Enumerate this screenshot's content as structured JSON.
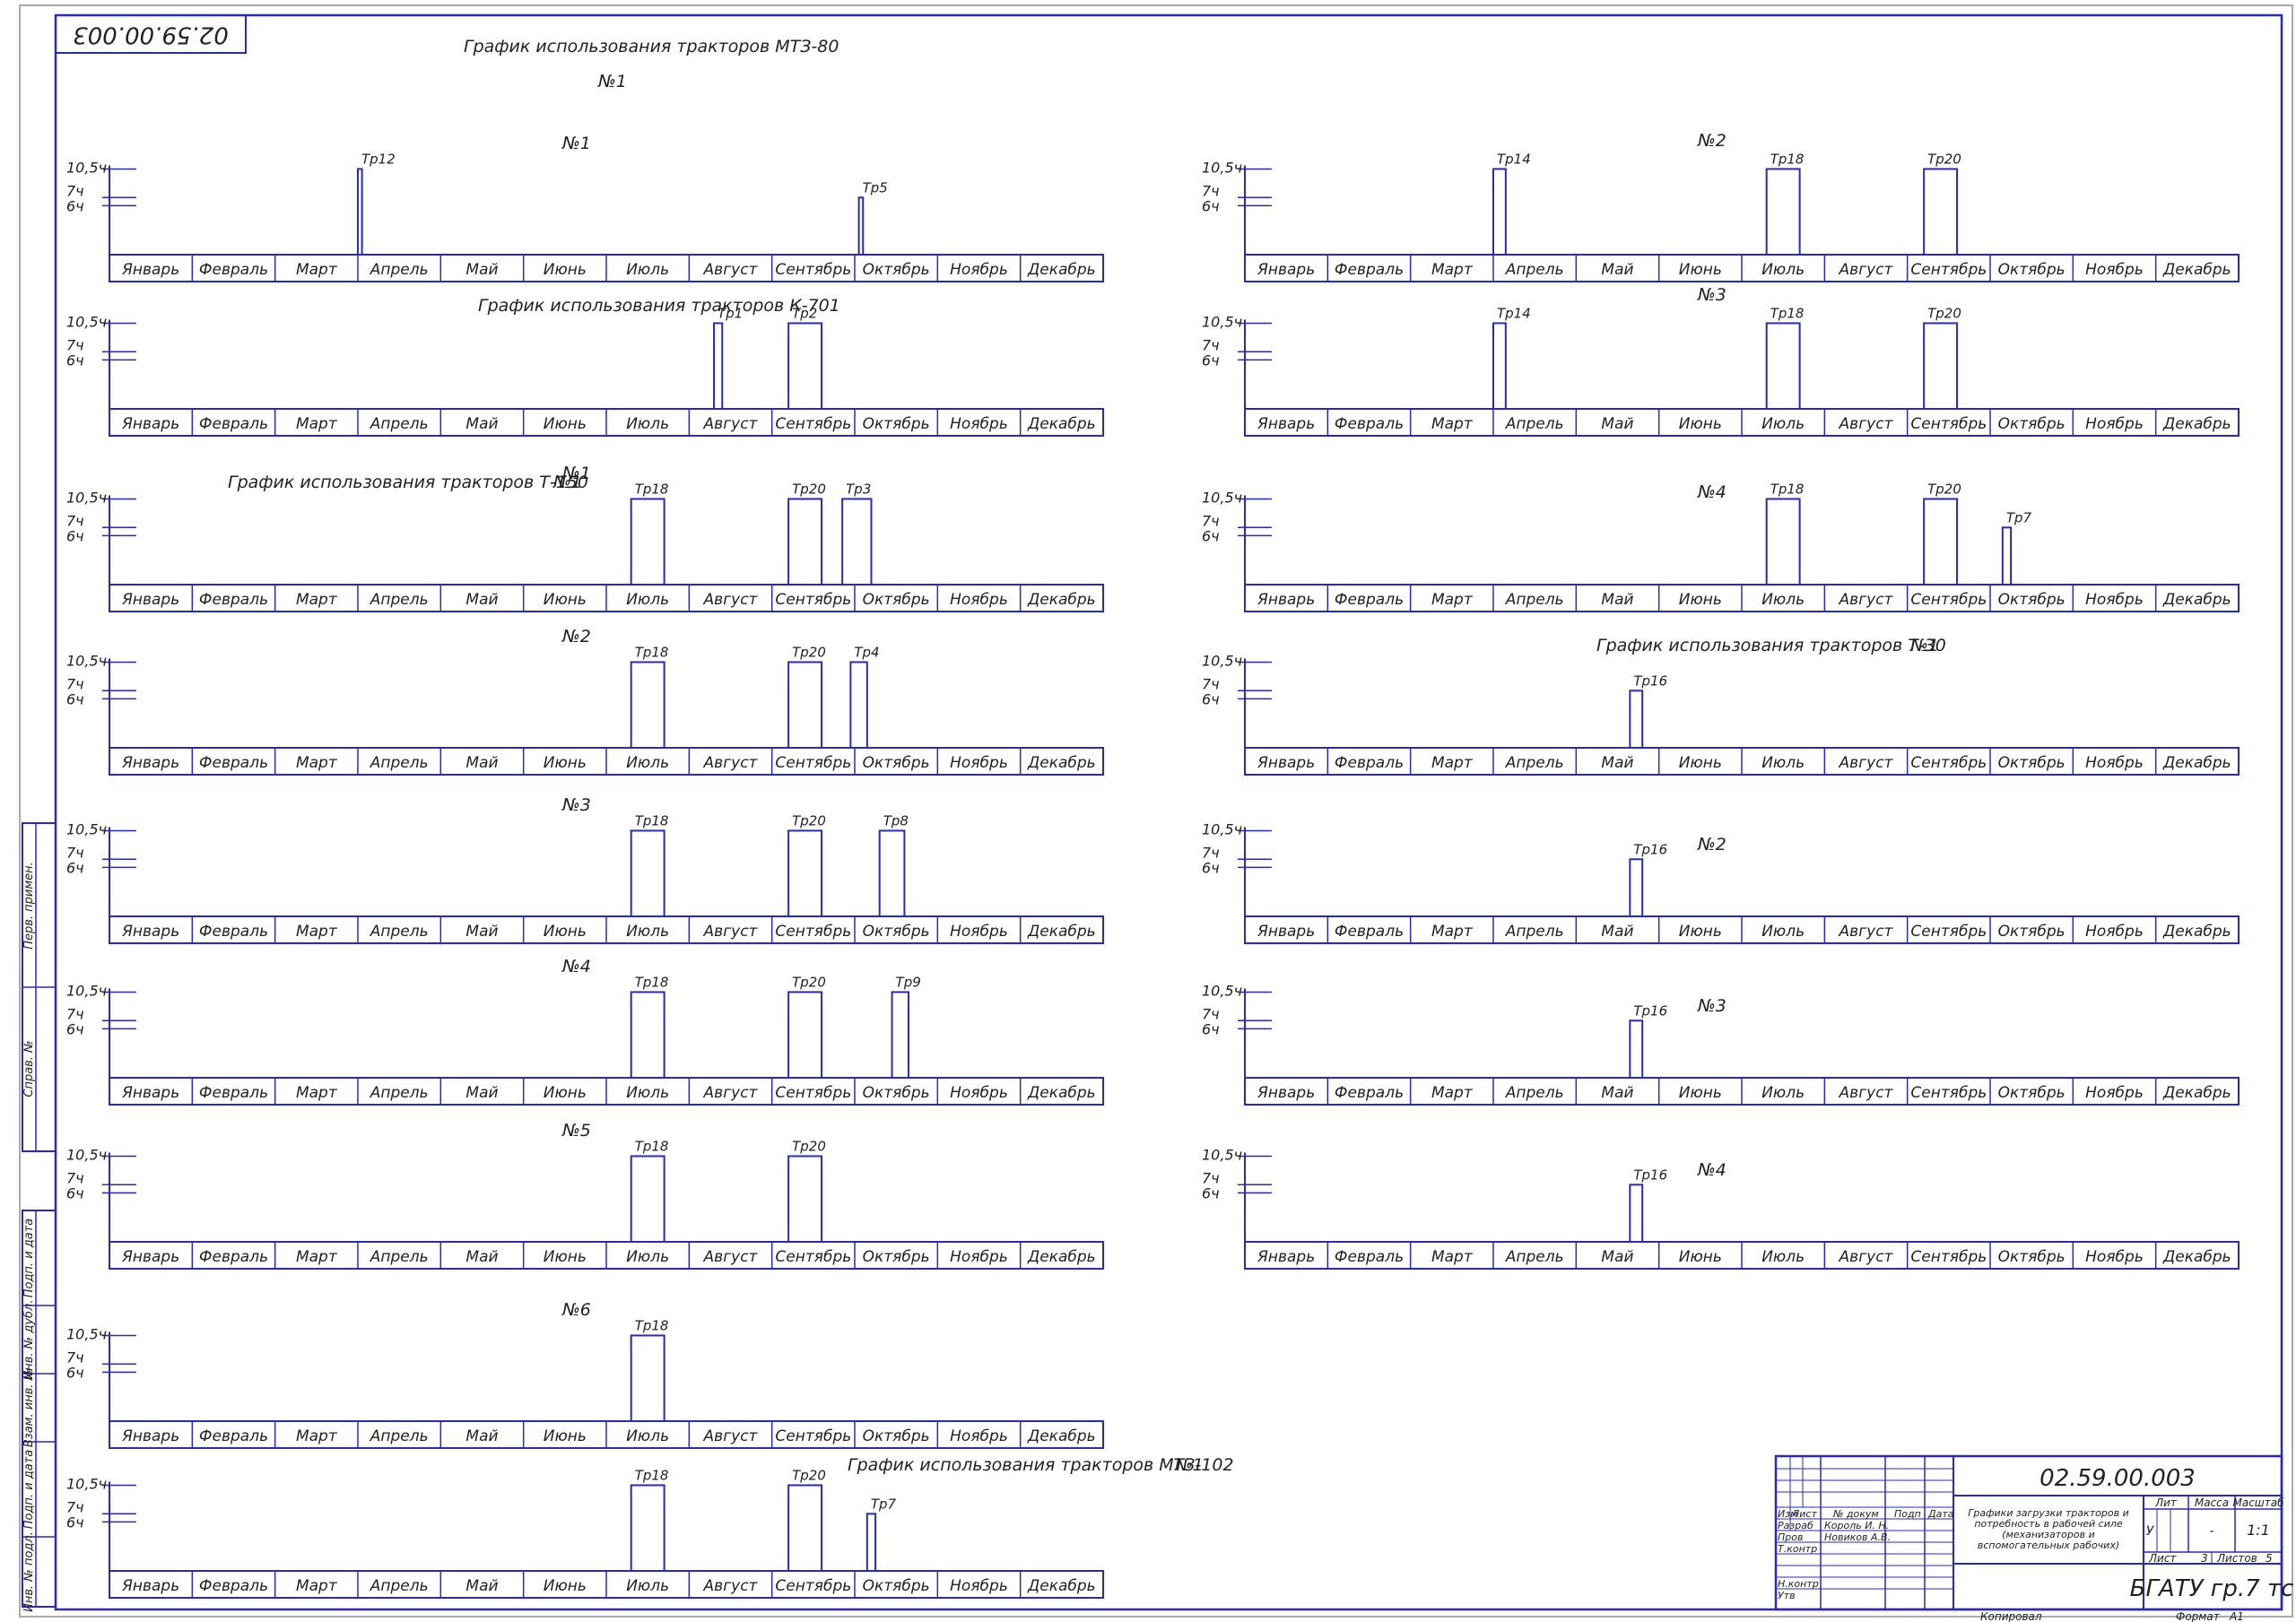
{
  "sheet": {
    "stamp_code_rotated": "02.59.00.003",
    "caption_mtz80": "График использования тракторов МТЗ-80",
    "caption_mtz80_no": "№1",
    "caption_k701": "График использования тракторов К-701",
    "caption_t150": "График использования тракторов Т-150",
    "caption_t150_no": "№1",
    "caption_t30": "График использования тракторов Т-30",
    "caption_t30_no": "№1",
    "caption_mtz102": "График использования тракторов МТЗ-102",
    "caption_mtz102_no": "№1"
  },
  "axis_labels": [
    "10,5ч",
    "7ч",
    "6ч"
  ],
  "months": [
    "Январь",
    "Февраль",
    "Март",
    "Апрель",
    "Май",
    "Июнь",
    "Июль",
    "Август",
    "Сентябрь",
    "Октябрь",
    "Ноябрь",
    "Декабрь"
  ],
  "chart_data": [
    {
      "type": "bar",
      "group": "МТЗ-80",
      "number": "№1",
      "bars": [
        {
          "label": "Тр12",
          "start_month": 3.0,
          "end_month": 3.05,
          "hours": 10.5
        },
        {
          "label": "Тр5",
          "start_month": 9.05,
          "end_month": 9.1,
          "hours": 7
        }
      ]
    },
    {
      "type": "bar",
      "group": "МТЗ-80",
      "number": "№2",
      "bars": [
        {
          "label": "Тр14",
          "start_month": 3.0,
          "end_month": 3.15,
          "hours": 10.5
        },
        {
          "label": "Тр18",
          "start_month": 6.3,
          "end_month": 6.7,
          "hours": 10.5
        },
        {
          "label": "Тр20",
          "start_month": 8.2,
          "end_month": 8.6,
          "hours": 10.5
        }
      ]
    },
    {
      "type": "bar",
      "group": "К-701",
      "number": "",
      "bars": [
        {
          "label": "Тр1",
          "start_month": 7.3,
          "end_month": 7.4,
          "hours": 10.5
        },
        {
          "label": "Тр2",
          "start_month": 8.2,
          "end_month": 8.6,
          "hours": 10.5
        }
      ]
    },
    {
      "type": "bar",
      "group": "МТЗ-80",
      "number": "№3",
      "bars": [
        {
          "label": "Тр14",
          "start_month": 3.0,
          "end_month": 3.15,
          "hours": 10.5
        },
        {
          "label": "Тр18",
          "start_month": 6.3,
          "end_month": 6.7,
          "hours": 10.5
        },
        {
          "label": "Тр20",
          "start_month": 8.2,
          "end_month": 8.6,
          "hours": 10.5
        }
      ]
    },
    {
      "type": "bar",
      "group": "Т-150",
      "number": "№1",
      "bars": [
        {
          "label": "Тр18",
          "start_month": 6.3,
          "end_month": 6.7,
          "hours": 10.5
        },
        {
          "label": "Тр20",
          "start_month": 8.2,
          "end_month": 8.6,
          "hours": 10.5
        },
        {
          "label": "Тр3",
          "start_month": 8.85,
          "end_month": 9.2,
          "hours": 10.5
        }
      ]
    },
    {
      "type": "bar",
      "group": "МТЗ-80",
      "number": "№4",
      "bars": [
        {
          "label": "Тр18",
          "start_month": 6.3,
          "end_month": 6.7,
          "hours": 10.5
        },
        {
          "label": "Тр20",
          "start_month": 8.2,
          "end_month": 8.6,
          "hours": 10.5
        },
        {
          "label": "Тр7",
          "start_month": 9.15,
          "end_month": 9.25,
          "hours": 7
        }
      ]
    },
    {
      "type": "bar",
      "group": "Т-150",
      "number": "№2",
      "bars": [
        {
          "label": "Тр18",
          "start_month": 6.3,
          "end_month": 6.7,
          "hours": 10.5
        },
        {
          "label": "Тр20",
          "start_month": 8.2,
          "end_month": 8.6,
          "hours": 10.5
        },
        {
          "label": "Тр4",
          "start_month": 8.95,
          "end_month": 9.15,
          "hours": 10.5
        }
      ]
    },
    {
      "type": "bar",
      "group": "Т-30",
      "number": "№1",
      "bars": [
        {
          "label": "Тр16",
          "start_month": 4.65,
          "end_month": 4.8,
          "hours": 7
        }
      ]
    },
    {
      "type": "bar",
      "group": "Т-150",
      "number": "№3",
      "bars": [
        {
          "label": "Тр18",
          "start_month": 6.3,
          "end_month": 6.7,
          "hours": 10.5
        },
        {
          "label": "Тр20",
          "start_month": 8.2,
          "end_month": 8.6,
          "hours": 10.5
        },
        {
          "label": "Тр8",
          "start_month": 9.3,
          "end_month": 9.6,
          "hours": 10.5
        }
      ]
    },
    {
      "type": "bar",
      "group": "Т-30",
      "number": "№2",
      "bars": [
        {
          "label": "Тр16",
          "start_month": 4.65,
          "end_month": 4.8,
          "hours": 7
        }
      ]
    },
    {
      "type": "bar",
      "group": "Т-150",
      "number": "№4",
      "bars": [
        {
          "label": "Тр18",
          "start_month": 6.3,
          "end_month": 6.7,
          "hours": 10.5
        },
        {
          "label": "Тр20",
          "start_month": 8.2,
          "end_month": 8.6,
          "hours": 10.5
        },
        {
          "label": "Тр9",
          "start_month": 9.45,
          "end_month": 9.65,
          "hours": 10.5
        }
      ]
    },
    {
      "type": "bar",
      "group": "Т-30",
      "number": "№3",
      "bars": [
        {
          "label": "Тр16",
          "start_month": 4.65,
          "end_month": 4.8,
          "hours": 7
        }
      ]
    },
    {
      "type": "bar",
      "group": "Т-150",
      "number": "№5",
      "bars": [
        {
          "label": "Тр18",
          "start_month": 6.3,
          "end_month": 6.7,
          "hours": 10.5
        },
        {
          "label": "Тр20",
          "start_month": 8.2,
          "end_month": 8.6,
          "hours": 10.5
        }
      ]
    },
    {
      "type": "bar",
      "group": "Т-30",
      "number": "№4",
      "bars": [
        {
          "label": "Тр16",
          "start_month": 4.65,
          "end_month": 4.8,
          "hours": 7
        }
      ]
    },
    {
      "type": "bar",
      "group": "Т-150",
      "number": "№6",
      "bars": [
        {
          "label": "Тр18",
          "start_month": 6.3,
          "end_month": 6.7,
          "hours": 10.5
        }
      ]
    },
    {
      "type": "bar",
      "group": "МТЗ-102",
      "number": "",
      "bars": [
        {
          "label": "Тр18",
          "start_month": 6.3,
          "end_month": 6.7,
          "hours": 10.5
        },
        {
          "label": "Тр20",
          "start_month": 8.2,
          "end_month": 8.6,
          "hours": 10.5
        },
        {
          "label": "Тр7",
          "start_month": 9.15,
          "end_month": 9.25,
          "hours": 7
        }
      ]
    }
  ],
  "side_stamp": [
    "Перв. примен.",
    "Справ. №",
    "Подп. и дата",
    "Инв. № дубл.",
    "Взам. инв. №",
    "Подп. и дата",
    "Инв. № подл."
  ],
  "title_block": {
    "code": "02.59.00.003",
    "title": "Графики загрузки тракторов и потребность в рабочей силе (механизаторов и вспомогательных рабочих)",
    "hdr_izm": "Изм",
    "hdr_list": "Лист",
    "hdr_doc": "№ докум",
    "hdr_podp": "Подп",
    "hdr_date": "Дата",
    "razrab_role": "Разраб",
    "razrab_name": "Король И. Н.",
    "prov_role": "Пров",
    "prov_name": "Новиков А.В.",
    "tkontr_role": "Т.контр",
    "nkontr_role": "Н.контр",
    "utv_role": "Утв",
    "lit": "Лит",
    "massa": "Масса",
    "masshtab": "Масштаб",
    "lit_val": "У",
    "massa_val": "-",
    "masshtab_val": "1:1",
    "sheet_label": "Лист",
    "sheet_no": "3",
    "sheets_label": "Листов",
    "sheets_total": "5",
    "org": "БГАТУ гр.7 тс",
    "kopiroval": "Копировал",
    "format_label": "Формат",
    "format_val": "А1"
  }
}
